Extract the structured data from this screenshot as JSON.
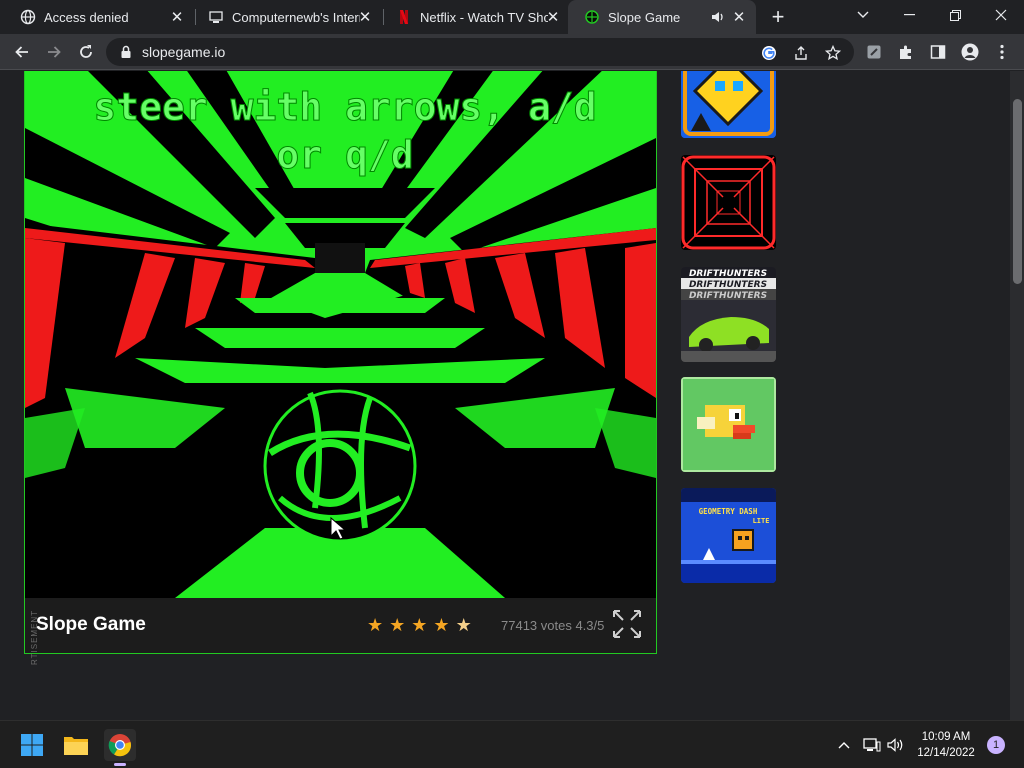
{
  "tabs": [
    {
      "title": "Access denied",
      "favicon": "globe-icon"
    },
    {
      "title": "Computernewb's Intern",
      "favicon": "computer-icon"
    },
    {
      "title": "Netflix - Watch TV Sho",
      "favicon": "netflix-icon"
    },
    {
      "title": "Slope Game",
      "favicon": "slope-icon",
      "audio": "speaker-icon"
    }
  ],
  "toolbar": {
    "url": "slopegame.io"
  },
  "game": {
    "overlay_line1": "steer with arrows, a/d",
    "overlay_line2": "or q/d",
    "title": "Slope Game",
    "rating_stars": 4.5,
    "votes_text": "77413 votes 4.3/5"
  },
  "sidebar": {
    "thumbs": [
      "geometry-dash-thumb",
      "tunnel-thumb",
      "drift-hunters-thumb",
      "flappy-bird-thumb",
      "geometry-dash-lite-thumb"
    ],
    "drift_hunters_text": "DRIFTHUNTERS",
    "gd_lite_line1": "GEOMETRY DASH",
    "gd_lite_line2": "LITE"
  },
  "ad_label": "RTISEMENT",
  "taskbar": {
    "time": "10:09 AM",
    "date": "12/14/2022",
    "notifications": "1"
  },
  "colors": {
    "accent_green": "#22c922",
    "star": "#f5a623",
    "chrome_dark": "#202124"
  }
}
